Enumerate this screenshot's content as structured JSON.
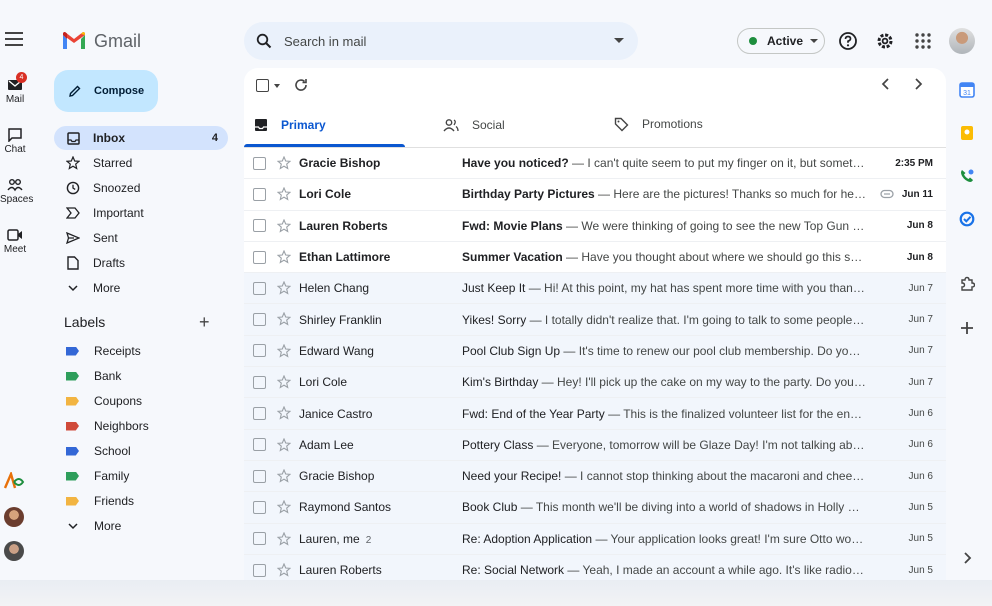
{
  "app": {
    "name": "Gmail"
  },
  "rail": {
    "items": [
      {
        "label": "Mail",
        "badge": "4",
        "icon": "mail-icon"
      },
      {
        "label": "Chat",
        "icon": "chat-icon"
      },
      {
        "label": "Spaces",
        "icon": "spaces-icon"
      },
      {
        "label": "Meet",
        "icon": "meet-icon"
      }
    ]
  },
  "compose": {
    "label": "Compose"
  },
  "nav": {
    "items": [
      {
        "label": "Inbox",
        "count": "4",
        "icon": "inbox-icon",
        "active": true
      },
      {
        "label": "Starred",
        "icon": "star-icon"
      },
      {
        "label": "Snoozed",
        "icon": "clock-icon"
      },
      {
        "label": "Important",
        "icon": "important-icon"
      },
      {
        "label": "Sent",
        "icon": "send-icon"
      },
      {
        "label": "Drafts",
        "icon": "draft-icon"
      },
      {
        "label": "More",
        "icon": "chevron-down-icon"
      }
    ]
  },
  "labels": {
    "heading": "Labels",
    "items": [
      {
        "label": "Receipts",
        "color": "#3367d6"
      },
      {
        "label": "Bank",
        "color": "#2e9e5b"
      },
      {
        "label": "Coupons",
        "color": "#f2b441"
      },
      {
        "label": "Neighbors",
        "color": "#d04a3a"
      },
      {
        "label": "School",
        "color": "#3367d6"
      },
      {
        "label": "Family",
        "color": "#2e9e5b"
      },
      {
        "label": "Friends",
        "color": "#f2b441"
      }
    ],
    "more": "More"
  },
  "search": {
    "placeholder": "Search in mail"
  },
  "status": {
    "label": "Active",
    "color": "#1e8e3e"
  },
  "tabs": [
    {
      "label": "Primary",
      "icon": "inbox-icon",
      "active": true
    },
    {
      "label": "Social",
      "icon": "people-icon"
    },
    {
      "label": "Promotions",
      "icon": "tag-icon"
    }
  ],
  "emails": [
    {
      "sender": "Gracie Bishop",
      "subject": "Have you noticed?",
      "snippet": " — I can't quite seem to put my finger on it, but something's different",
      "date": "2:35 PM",
      "unread": true
    },
    {
      "sender": "Lori Cole",
      "subject": "Birthday Party Pictures",
      "snippet": " — Here are the pictures! Thanks so much for helping out",
      "date": "Jun 11",
      "unread": true,
      "attachment": true
    },
    {
      "sender": "Lauren Roberts",
      "subject": "Fwd: Movie Plans",
      "snippet": " — We were thinking of going to see the new Top Gun movie",
      "date": "Jun 8",
      "unread": true
    },
    {
      "sender": "Ethan Lattimore",
      "subject": "Summer Vacation",
      "snippet": " — Have you thought about where we should go this summer",
      "date": "Jun 8",
      "unread": true
    },
    {
      "sender": "Helen Chang",
      "subject": "Just Keep It",
      "snippet": " — Hi! At this point, my hat has spent more time with you than with me",
      "date": "Jun 7",
      "unread": false
    },
    {
      "sender": "Shirley Franklin",
      "subject": "Yikes! Sorry",
      "snippet": " — I totally didn't realize that. I'm going to talk to some people about it",
      "date": "Jun 7",
      "unread": false
    },
    {
      "sender": "Edward Wang",
      "subject": "Pool Club Sign Up",
      "snippet": " — It's time to renew our pool club membership. Do you remember",
      "date": "Jun 7",
      "unread": false
    },
    {
      "sender": "Lori Cole",
      "subject": "Kim's Birthday",
      "snippet": " — Hey! I'll pick up the cake on my way to the party. Do you think",
      "date": "Jun 7",
      "unread": false
    },
    {
      "sender": "Janice Castro",
      "subject": "Fwd: End of the Year Party",
      "snippet": " — This is the finalized volunteer list for the end of the year",
      "date": "Jun 6",
      "unread": false
    },
    {
      "sender": "Adam Lee",
      "subject": "Pottery Class",
      "snippet": " — Everyone, tomorrow will be Glaze Day! I'm not talking about donuts",
      "date": "Jun 6",
      "unread": false
    },
    {
      "sender": "Gracie Bishop",
      "subject": "Need your Recipe!",
      "snippet": " — I cannot stop thinking about the macaroni and cheese you made",
      "date": "Jun 6",
      "unread": false
    },
    {
      "sender": "Raymond Santos",
      "subject": "Book Club",
      "snippet": " — This month we'll be diving into a world of shadows in Holly Black's",
      "date": "Jun 5",
      "unread": false
    },
    {
      "sender": "Lauren, me",
      "count": "2",
      "subject": "Re: Adoption Application",
      "snippet": " — Your application looks great! I'm sure Otto would love",
      "date": "Jun 5",
      "unread": false
    },
    {
      "sender": "Lauren Roberts",
      "subject": "Re: Social Network",
      "snippet": " — Yeah, I made an account a while ago. It's like radio but",
      "date": "Jun 5",
      "unread": false
    }
  ],
  "side_panel": {
    "icons": [
      "calendar-icon",
      "keep-icon",
      "contacts-icon",
      "tasks-icon",
      "addons-icon",
      "add-icon",
      "chevron-right-icon"
    ]
  }
}
